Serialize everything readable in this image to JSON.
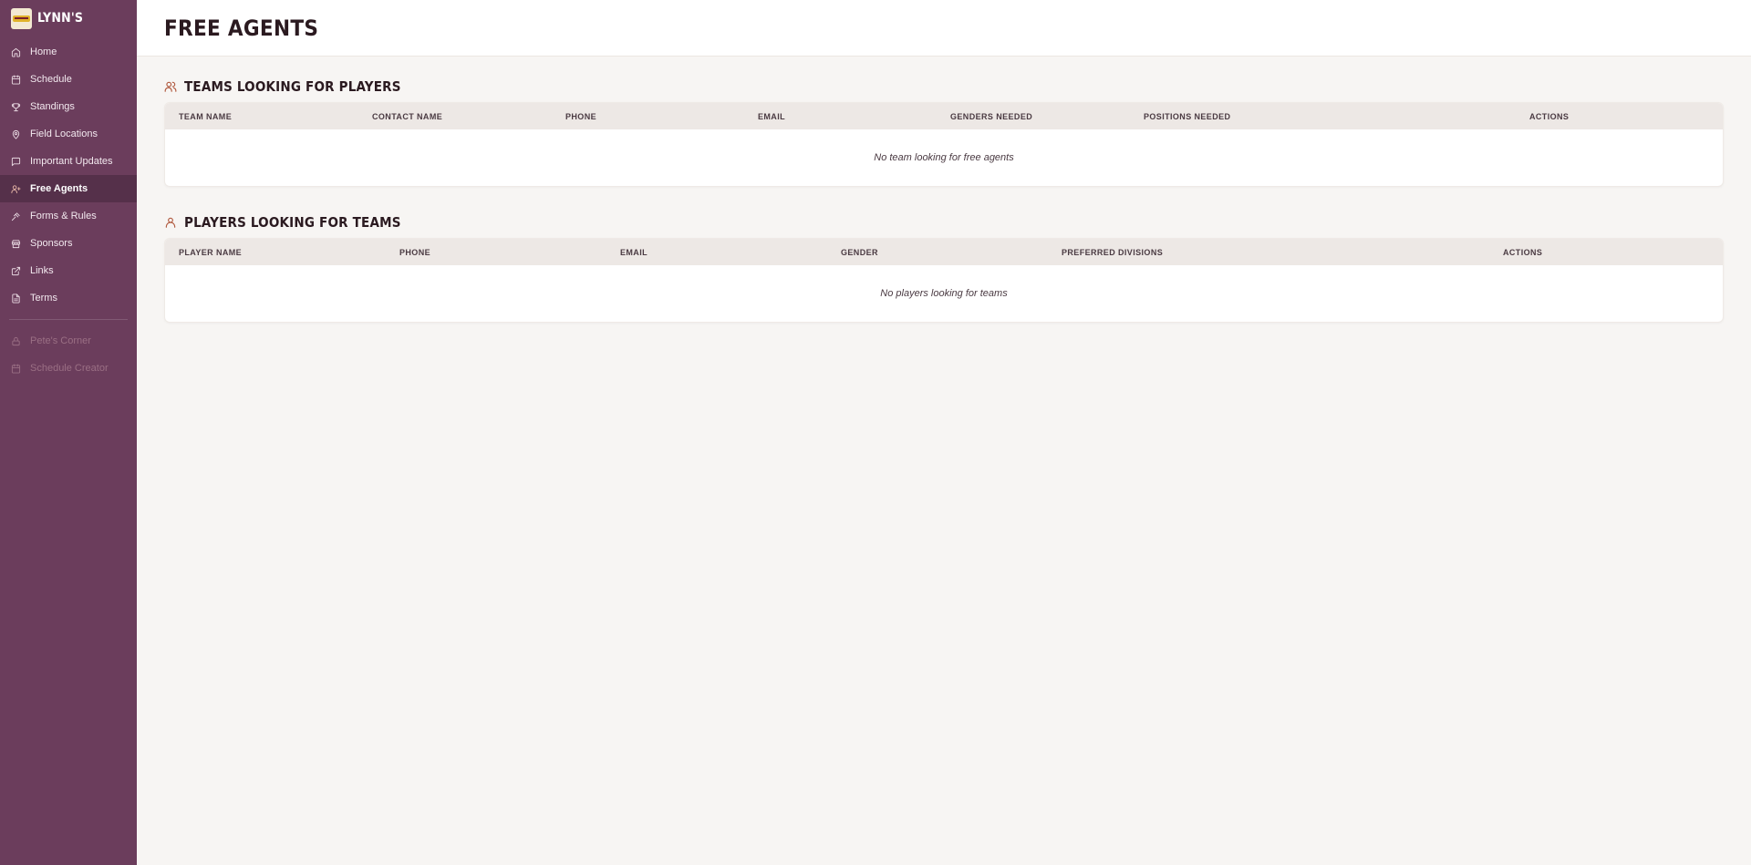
{
  "brand": {
    "name": "LYNN'S",
    "logo_icon": "lynns-logo-icon"
  },
  "sidebar": {
    "items": [
      {
        "label": "Home",
        "icon": "home-icon"
      },
      {
        "label": "Schedule",
        "icon": "calendar-icon"
      },
      {
        "label": "Standings",
        "icon": "trophy-icon"
      },
      {
        "label": "Field Locations",
        "icon": "map-pin-icon"
      },
      {
        "label": "Important Updates",
        "icon": "message-icon"
      },
      {
        "label": "Free Agents",
        "icon": "user-plus-icon",
        "active": true
      },
      {
        "label": "Forms & Rules",
        "icon": "gavel-icon"
      },
      {
        "label": "Sponsors",
        "icon": "store-icon"
      },
      {
        "label": "Links",
        "icon": "external-link-icon"
      },
      {
        "label": "Terms",
        "icon": "file-icon"
      }
    ],
    "locked_items": [
      {
        "label": "Pete's Corner",
        "icon": "lock-icon"
      },
      {
        "label": "Schedule Creator",
        "icon": "calendar-icon"
      }
    ]
  },
  "header": {
    "title": "FREE AGENTS"
  },
  "teams_section": {
    "title": "TEAMS LOOKING FOR PLAYERS",
    "icon": "users-icon",
    "columns": [
      "TEAM NAME",
      "CONTACT NAME",
      "PHONE",
      "EMAIL",
      "GENDERS NEEDED",
      "POSITIONS NEEDED",
      "ACTIONS"
    ],
    "empty_text": "No team looking for free agents"
  },
  "players_section": {
    "title": "PLAYERS LOOKING FOR TEAMS",
    "icon": "user-icon",
    "columns": [
      "PLAYER NAME",
      "PHONE",
      "EMAIL",
      "GENDER",
      "PREFERRED DIVISIONS",
      "ACTIONS"
    ],
    "empty_text": "No players looking for teams"
  },
  "colors": {
    "sidebar_bg": "#6b3d5c",
    "sidebar_active_bg": "#55304a",
    "accent": "#b0583d",
    "page_bg": "#f7f5f3"
  }
}
